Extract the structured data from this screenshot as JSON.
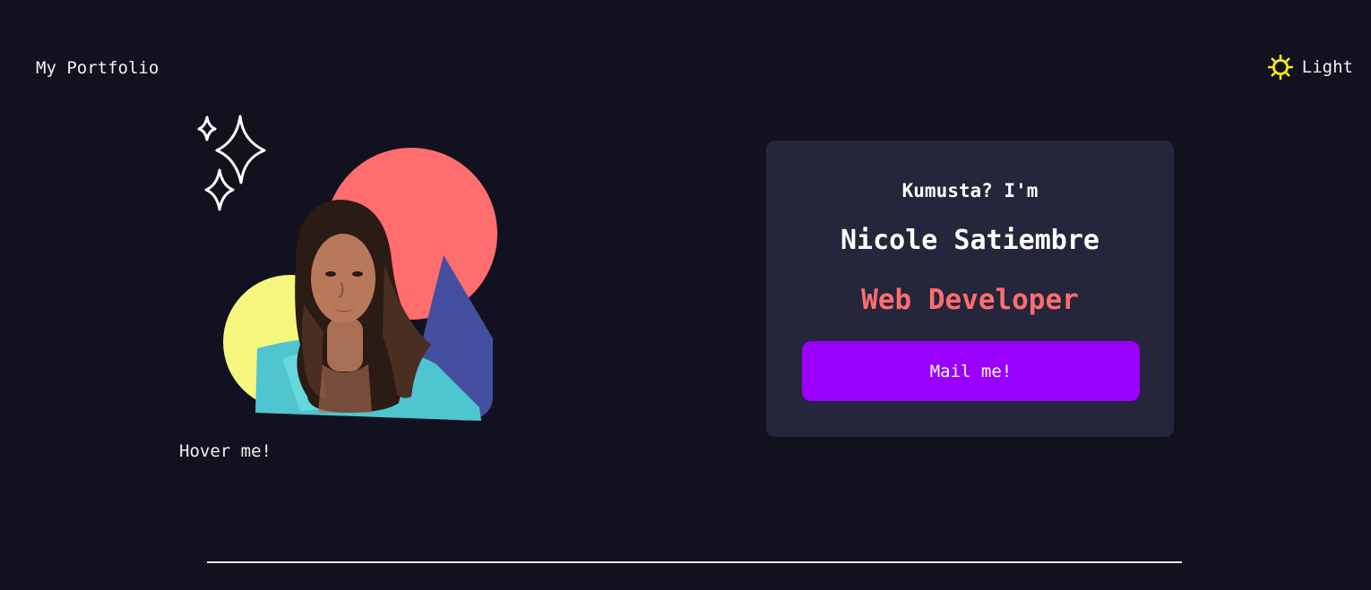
{
  "header": {
    "brand": "My Portfolio",
    "theme_toggle_label": "Light",
    "theme_toggle_icon": "sun-icon"
  },
  "hero": {
    "hover_label": "Hover me!",
    "greeting": "Kumusta? I'm",
    "name": "Nicole Satiembre",
    "role": "Web Developer",
    "mail_button_label": "Mail me!"
  },
  "colors": {
    "background": "#12111f",
    "card": "#25253b",
    "accent_role": "#ff6e6e",
    "button": "#9900ff",
    "sun": "#ffe81a",
    "shape_circle_red": "#ff6e6e",
    "shape_circle_yellow": "#f5f77e",
    "shape_triangle_blue": "#454fa0"
  }
}
